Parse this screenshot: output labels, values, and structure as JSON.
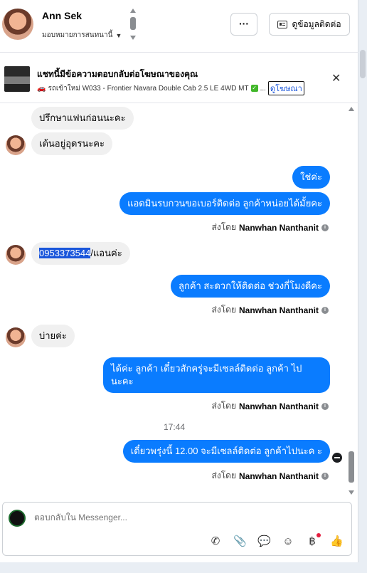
{
  "header": {
    "name": "Ann Sek",
    "assign_label": "มอบหมายการสนทนานี้",
    "more_label": "···",
    "contact_button": "ดูข้อมูลติดต่อ"
  },
  "ad": {
    "title": "แชทนี้มีข้อความตอบกลับต่อโฆษณาของคุณ",
    "subtitle": "รถเข้าใหม่ W033 - Frontier Navara Double Cab 2.5 LE 4WD MT",
    "ellipsis": "...",
    "link": "ดูโฆษณา",
    "close": "✕"
  },
  "messages": [
    {
      "dir": "in",
      "text": "ปรึกษาแฟนก่อนนะคะ"
    },
    {
      "dir": "in",
      "text": "เต้นอยู่อุดรนะคะ"
    },
    {
      "dir": "out",
      "text": "ใช่ค่ะ"
    },
    {
      "dir": "out",
      "text": "แอดมินรบกวนขอเบอร์ติดต่อ ลูกค้าหน่อยได้มั้ยคะ"
    },
    {
      "dir": "in",
      "text_highlight": "0953373544",
      "text_rest": "/แอนค่ะ"
    },
    {
      "dir": "out",
      "text": "ลูกค้า สะดวกให้ติดต่อ ช่วงกี่โมงดีคะ"
    },
    {
      "dir": "in",
      "text": "บ่ายค่ะ"
    },
    {
      "dir": "out",
      "text_line1": "ได้ค่ะ  ลูกค้า เดี๋ยวสักครู่จะมีเซลล์ติดต่อ ลูกค้า ไป",
      "text_line2": "นะคะ"
    },
    {
      "dir": "out",
      "text": "เดี๋ยวพรุ่งนี้  12.00 จะมีเซลล์ติดต่อ ลูกค้าไปนะค ะ"
    }
  ],
  "sent_by": {
    "prefix": "ส่งโดย",
    "name": "Nanwhan Nanthanit"
  },
  "timestamp": "17:44",
  "composer": {
    "placeholder": "ตอบกลับใน Messenger..."
  },
  "colors": {
    "outgoing_bubble": "#0a7cff",
    "incoming_bubble": "#f0f0f0",
    "link_blue": "#1a56db"
  }
}
